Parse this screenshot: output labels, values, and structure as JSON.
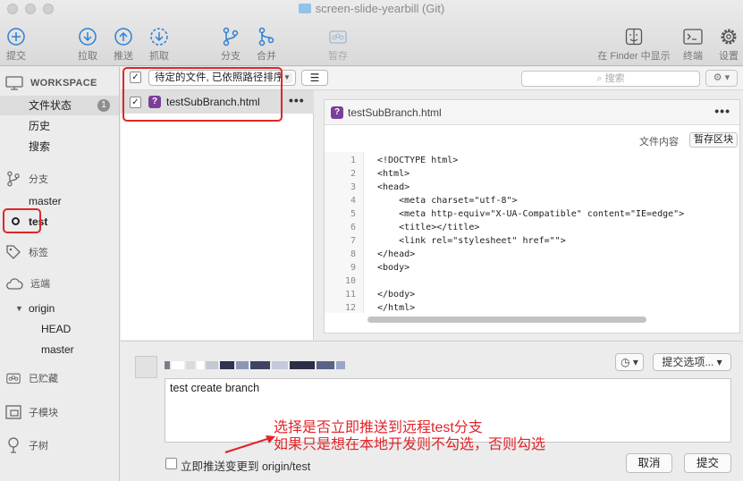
{
  "window": {
    "title": "screen-slide-yearbill (Git)"
  },
  "toolbar": {
    "commit": "提交",
    "pull": "拉取",
    "push": "推送",
    "fetch": "抓取",
    "branch": "分支",
    "merge": "合并",
    "stash": "暂存",
    "show_in_finder": "在 Finder 中显示",
    "terminal": "终端",
    "settings": "设置"
  },
  "sidebar": {
    "workspace": "WORKSPACE",
    "file_status": "文件状态",
    "file_status_count": "1",
    "history": "历史",
    "search": "搜索",
    "branches_header": "分支",
    "branches": [
      "master",
      "test"
    ],
    "tags_header": "标签",
    "remotes_header": "远端",
    "remote_name": "origin",
    "remote_branches": [
      "HEAD",
      "master"
    ],
    "stashes_header": "已贮藏",
    "submodules_header": "子模块",
    "subtrees_header": "子树"
  },
  "filter": {
    "mode": "待定的文件, 已依照路径排序",
    "search_placeholder": "搜索"
  },
  "files": [
    {
      "name": "testSubBranch.html",
      "status_icon": "?"
    }
  ],
  "diff": {
    "file_name": "testSubBranch.html",
    "content_label": "文件内容",
    "stage_button": "暂存区块",
    "lines": [
      {
        "n": "1",
        "text": "<!DOCTYPE html>"
      },
      {
        "n": "2",
        "text": "<html>"
      },
      {
        "n": "3",
        "text": "<head>"
      },
      {
        "n": "4",
        "text": "    <meta charset=\"utf-8\">"
      },
      {
        "n": "5",
        "text": "    <meta http-equiv=\"X-UA-Compatible\" content=\"IE=edge\">"
      },
      {
        "n": "6",
        "text": "    <title></title>"
      },
      {
        "n": "7",
        "text": "    <link rel=\"stylesheet\" href=\"\">"
      },
      {
        "n": "8",
        "text": "</head>"
      },
      {
        "n": "9",
        "text": "<body>"
      },
      {
        "n": "10",
        "text": ""
      },
      {
        "n": "11",
        "text": "</body>"
      },
      {
        "n": "12",
        "text": "</html>"
      }
    ]
  },
  "commit": {
    "message": "test create branch",
    "options_button": "提交选项...",
    "push_label": "立即推送变更到 origin/test",
    "cancel": "取消",
    "submit": "提交"
  },
  "annotation": {
    "line1": "选择是否立即推送到远程test分支",
    "line2": "如果只是想在本地开发则不勾选，否则勾选",
    "color": "#e0252a"
  }
}
